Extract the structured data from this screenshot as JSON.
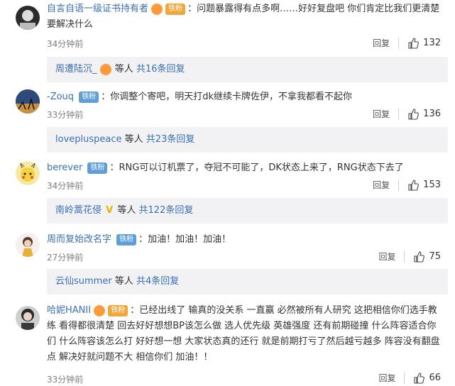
{
  "comments": [
    {
      "user": "自言自语一级证书持有者",
      "badge": "铁粉",
      "text": "问题暴露得有点多啊……好好复盘吧 你们肯定比我们更清楚要解决什么",
      "time": "34分钟前",
      "reply_label": "回复",
      "likes": "132",
      "replies_user": "周遭陆沉_",
      "replies_suffix": "等人",
      "replies_count": "共16条回复"
    },
    {
      "user": "-Zouq",
      "badge": "铁粉",
      "text": "你调整个寄吧，明天打dk继续卡牌佐伊，不拿我都看不起你",
      "time": "33分钟前",
      "reply_label": "回复",
      "likes": "136",
      "replies_user": "lovepluspeace",
      "replies_suffix": "等人",
      "replies_count": "共23条回复"
    },
    {
      "user": "berever",
      "badge": "铁粉",
      "text": "RNG可以订机票了，夺冠不可能了，DK状态上来了，RNG状态下去了",
      "time": "34分钟前",
      "reply_label": "回复",
      "likes": "153",
      "replies_user": "南岭蒿花侵",
      "replies_mark": "V",
      "replies_suffix": "等人",
      "replies_count": "共122条回复"
    },
    {
      "user": "周而复始改名字",
      "badge": "铁粉",
      "text": "加油！加油！加油！",
      "time": "27分钟前",
      "reply_label": "回复",
      "likes": "75",
      "replies_user": "云仙summer",
      "replies_suffix": "等人",
      "replies_count": "共4条回复"
    },
    {
      "user": "哈妮HANII",
      "badge": "铁粉",
      "text": "已经出线了 输真的没关系 一直赢 必然被所有人研究 这把相信你们选手教练 看得都很清楚 回去好好想想BP该怎么做 选人优先级 英雄强度 还有前期碰撞 什么阵容适合你们 什么阵容该怎么打  好好想一想 大家状态真的还行 就是前期打亏了然后越亏越多 阵容没有翻盘点 解决好就问题不大 相信你们 加油！！",
      "time": "33分钟前",
      "reply_label": "回复",
      "likes": "66"
    }
  ]
}
